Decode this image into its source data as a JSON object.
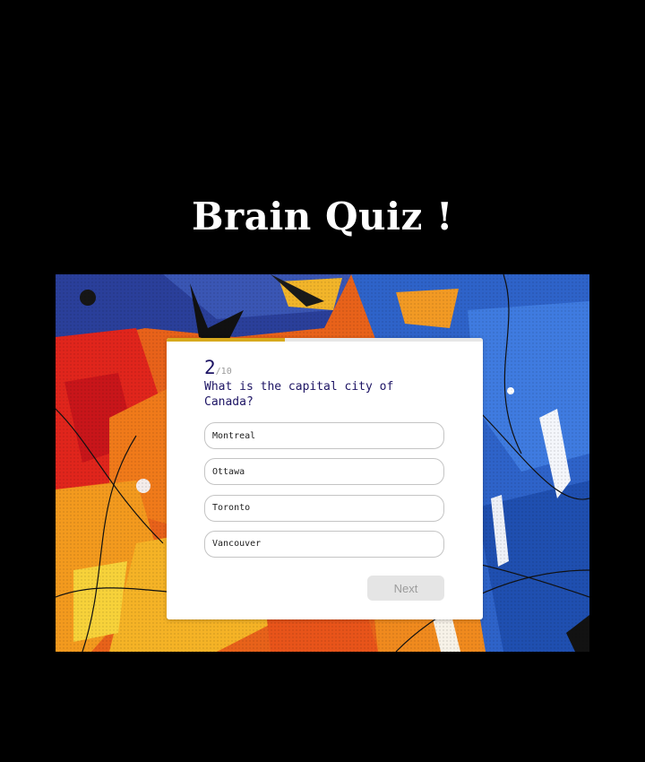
{
  "app": {
    "title": "Brain Quiz !"
  },
  "quiz": {
    "current_question": "2",
    "total_questions": "/10",
    "progress_fraction": 0.375,
    "question_text": "What is the capital city of Canada?",
    "options": [
      {
        "label": "Montreal"
      },
      {
        "label": "Ottawa"
      },
      {
        "label": "Toronto"
      },
      {
        "label": "Vancouver"
      }
    ],
    "next_label": "Next",
    "next_disabled": true
  },
  "colors": {
    "page_background": "#000000",
    "title_color": "#ffffff",
    "progress_color": "#d7a91d",
    "question_color": "#1d1464",
    "next_button_bg": "#e5e5e5"
  },
  "background_image": {
    "description_icon": "abstract-paint-background"
  }
}
